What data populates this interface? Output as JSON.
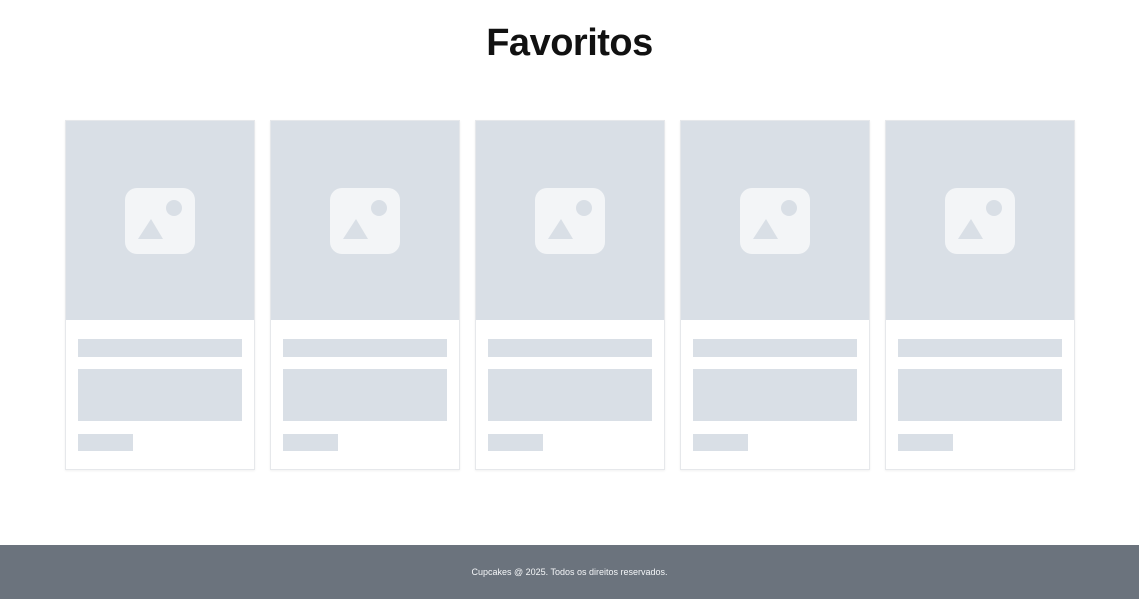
{
  "page": {
    "title": "Favoritos"
  },
  "favorites": {
    "cards": [
      {
        "image_icon": "image-placeholder-icon",
        "state": "loading"
      },
      {
        "image_icon": "image-placeholder-icon",
        "state": "loading"
      },
      {
        "image_icon": "image-placeholder-icon",
        "state": "loading"
      },
      {
        "image_icon": "image-placeholder-icon",
        "state": "loading"
      },
      {
        "image_icon": "image-placeholder-icon",
        "state": "loading"
      }
    ]
  },
  "footer": {
    "text": "Cupcakes @ 2025. Todos os direitos reservados."
  },
  "colors": {
    "skeleton": "#d9dfe6",
    "footer_background": "#6b737d",
    "title": "#111111"
  }
}
